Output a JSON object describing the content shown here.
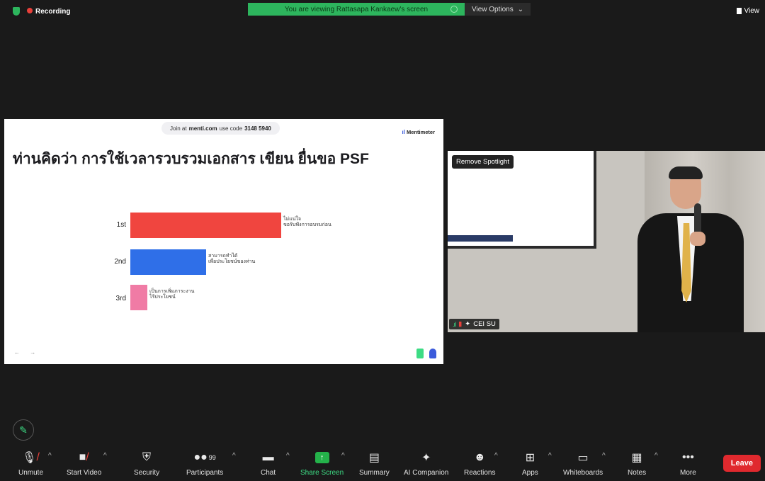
{
  "status": {
    "recording_label": "Recording"
  },
  "banner": {
    "text": "You are viewing Rattasapa Kankaew's screen",
    "view_options": "View Options",
    "view": "View"
  },
  "slide": {
    "join_prefix": "Join at",
    "join_site": "menti.com",
    "join_mid": "use code",
    "join_code": "3148 5940",
    "brand": "Mentimeter",
    "question": "ท่านคิดว่า การใช้เวลารวบรวมเอกสาร เขียน ยื่นขอ PSF",
    "results": [
      {
        "rank": "1st",
        "line1": "ไม่แน่ใจ",
        "line2": "ขอรับฟังการอบรมก่อน",
        "value": 0.72,
        "color": "#f0453f"
      },
      {
        "rank": "2nd",
        "line1": "สามารถทำได้",
        "line2": "เพื่อประโยชน์ของท่าน",
        "value": 0.36,
        "color": "#2f6fe8"
      },
      {
        "rank": "3rd",
        "line1": "เป็นการเพิ่มภาระงาน",
        "line2": "ไร้ประโยชน์",
        "value": 0.08,
        "color": "#f07ba5"
      }
    ],
    "nav": "← →"
  },
  "video": {
    "remove_spotlight": "Remove Spotlight",
    "name": "CEI SU"
  },
  "toolbar": {
    "unmute": "Unmute",
    "start_video": "Start Video",
    "security": "Security",
    "participants": "Participants",
    "participants_count": "99",
    "chat": "Chat",
    "share_screen": "Share Screen",
    "summary": "Summary",
    "ai_companion": "AI Companion",
    "reactions": "Reactions",
    "apps": "Apps",
    "whiteboards": "Whiteboards",
    "notes": "Notes",
    "more": "More",
    "leave": "Leave"
  }
}
